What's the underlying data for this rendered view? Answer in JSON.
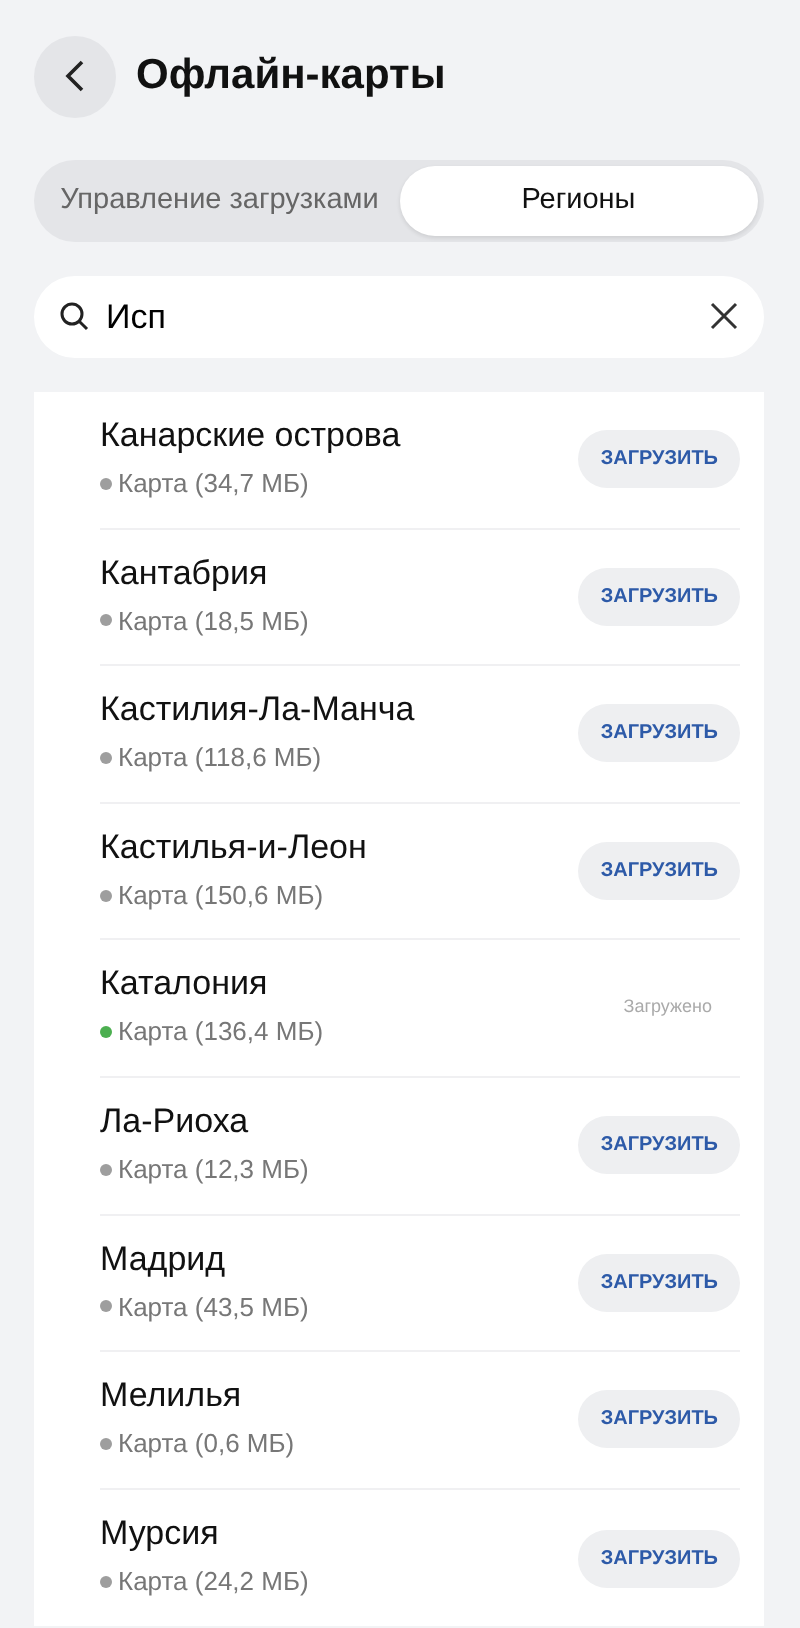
{
  "header": {
    "title": "Офлайн-карты"
  },
  "tabs": [
    {
      "label": "Управление загрузками",
      "selected": false
    },
    {
      "label": "Регионы",
      "selected": true
    }
  ],
  "search": {
    "value": "Исп"
  },
  "regions": [
    {
      "name": "Канарские острова",
      "size": "Карта (34,7 МБ)",
      "color": "#9e9e9e",
      "kind": "available",
      "action": "ЗАГРУЗИТЬ"
    },
    {
      "name": "Кантабрия",
      "size": "Карта (18,5 МБ)",
      "color": "#9e9e9e",
      "kind": "available",
      "action": "ЗАГРУЗИТЬ"
    },
    {
      "name": "Кастилия-Ла-Манча",
      "size": "Карта (118,6 МБ)",
      "color": "#9e9e9e",
      "kind": "available",
      "action": "ЗАГРУЗИТЬ"
    },
    {
      "name": "Кастилья-и-Леон",
      "size": "Карта (150,6 МБ)",
      "color": "#9e9e9e",
      "kind": "available",
      "action": "ЗАГРУЗИТЬ"
    },
    {
      "name": "Каталония",
      "size": "Карта (136,4 МБ)",
      "color": "#4caf50",
      "kind": "downloaded",
      "action": "Загружено"
    },
    {
      "name": "Ла-Риоха",
      "size": "Карта (12,3 МБ)",
      "color": "#9e9e9e",
      "kind": "available",
      "action": "ЗАГРУЗИТЬ"
    },
    {
      "name": "Мадрид",
      "size": "Карта (43,5 МБ)",
      "color": "#9e9e9e",
      "kind": "available",
      "action": "ЗАГРУЗИТЬ"
    },
    {
      "name": "Мелилья",
      "size": "Карта (0,6 МБ)",
      "color": "#9e9e9e",
      "kind": "available",
      "action": "ЗАГРУЗИТЬ"
    },
    {
      "name": "Мурсия",
      "size": "Карта (24,2 МБ)",
      "color": "#9e9e9e",
      "kind": "available",
      "action": "ЗАГРУЗИТЬ"
    }
  ]
}
